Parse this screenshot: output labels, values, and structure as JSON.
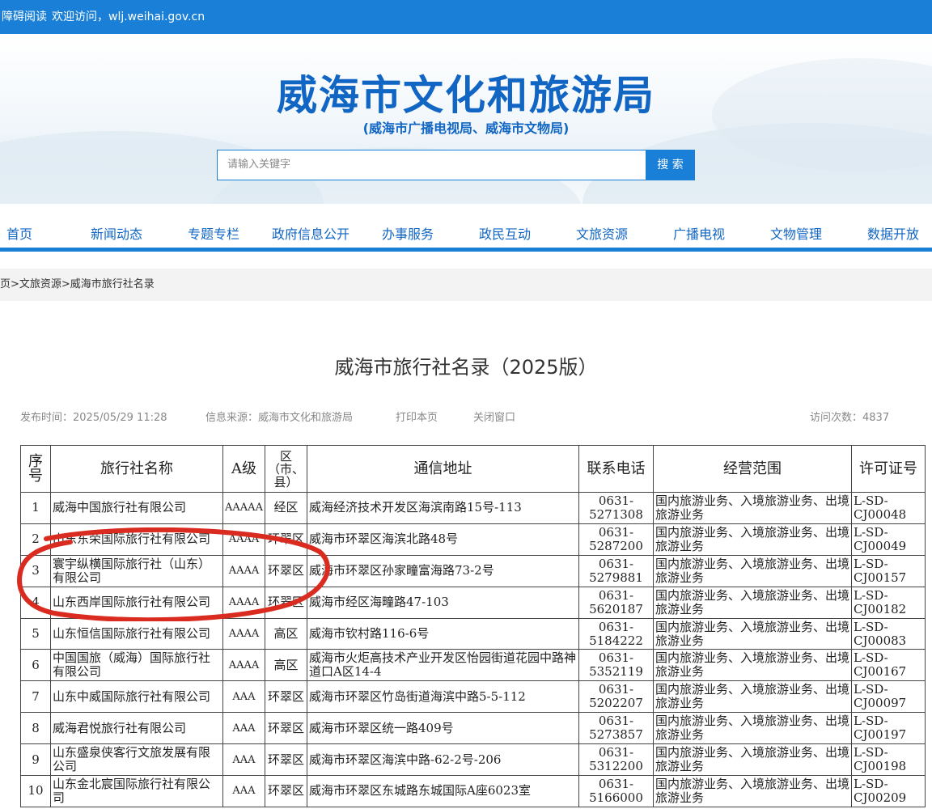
{
  "topbar": {
    "accessibility": "障碍阅读",
    "welcome": "欢迎访问，wlj.weihai.gov.cn"
  },
  "header": {
    "title": "威海市文化和旅游局",
    "subtitle": "(威海市广播电视局、威海市文物局)"
  },
  "search": {
    "placeholder": "请输入关键字",
    "button": "搜 索"
  },
  "nav": {
    "items": [
      "首页",
      "新闻动态",
      "专题专栏",
      "政府信息公开",
      "办事服务",
      "政民互动",
      "文旅资源",
      "广播电视",
      "文物管理",
      "数据开放"
    ]
  },
  "breadcrumb": "页>文旅资源>威海市旅行社名录",
  "article": {
    "title": "威海市旅行社名录（2025版）",
    "publish_time": "发布时间：2025/05/29 11:28",
    "source": "信息来源：威海市文化和旅游局",
    "print": "打印本页",
    "close": "关闭窗口",
    "visits": "访问次数：4837"
  },
  "table": {
    "headers": {
      "no": "序号",
      "name": "旅行社名称",
      "grade": "A级",
      "district": "区（市、县）",
      "address": "通信地址",
      "phone": "联系电话",
      "scope": "经营范围",
      "license": "许可证号"
    },
    "rows": [
      {
        "no": "1",
        "name": "威海中国旅行社有限公司",
        "grade": "AAAAA",
        "district": "经区",
        "address": "威海经济技术开发区海滨南路15号-113",
        "phone": "0631-5271308",
        "scope": "国内旅游业务、入境旅游业务、出境旅游业务",
        "license": "L-SD-CJ00048"
      },
      {
        "no": "2",
        "name": "山东东荣国际旅行社有限公司",
        "grade": "AAAA",
        "district": "环翠区",
        "address": "威海市环翠区海滨北路48号",
        "phone": "0631-5287200",
        "scope": "国内旅游业务、入境旅游业务、出境旅游业务",
        "license": "L-SD-CJ00049"
      },
      {
        "no": "3",
        "name": "寰宇纵横国际旅行社（山东）有限公司",
        "grade": "AAAA",
        "district": "环翠区",
        "address": "威海市环翠区孙家疃富海路73-2号",
        "phone": "0631-5279881",
        "scope": "国内旅游业务、入境旅游业务、出境旅游业务",
        "license": "L-SD-CJ00157"
      },
      {
        "no": "4",
        "name": "山东西岸国际旅行社有限公司",
        "grade": "AAAA",
        "district": "环翠区",
        "address": "威海市经区海疃路47-103",
        "phone": "0631-5620187",
        "scope": "国内旅游业务、入境旅游业务、出境旅游业务",
        "license": "L-SD-CJ00182"
      },
      {
        "no": "5",
        "name": "山东恒信国际旅行社有限公司",
        "grade": "AAAA",
        "district": "高区",
        "address": "威海市钦村路116-6号",
        "phone": "0631-5184222",
        "scope": "国内旅游业务、入境旅游业务、出境旅游业务",
        "license": "L-SD-CJ00083"
      },
      {
        "no": "6",
        "name": "中国国旅（威海）国际旅行社有限公司",
        "grade": "AAAA",
        "district": "高区",
        "address": "威海市火炬高技术产业开发区怡园街道花园中路神道口A区14-4",
        "phone": "0631-5352119",
        "scope": "国内旅游业务、入境旅游业务、出境旅游业务",
        "license": "L-SD-CJ00167"
      },
      {
        "no": "7",
        "name": "山东中威国际旅行社有限公司",
        "grade": "AAA",
        "district": "环翠区",
        "address": "威海市环翠区竹岛街道海滨中路5-5-112",
        "phone": "0631-5202207",
        "scope": "国内旅游业务、入境旅游业务、出境旅游业务",
        "license": "L-SD-CJ00097"
      },
      {
        "no": "8",
        "name": "威海君悦旅行社有限公司",
        "grade": "AAA",
        "district": "环翠区",
        "address": "威海市环翠区统一路409号",
        "phone": "0631-5273857",
        "scope": "国内旅游业务、入境旅游业务、出境旅游业务",
        "license": "L-SD-CJ00197"
      },
      {
        "no": "9",
        "name": "山东盛泉侠客行文旅发展有限公司",
        "grade": "AAA",
        "district": "环翠区",
        "address": "威海市环翠区海滨中路-62-2号-206",
        "phone": "0631-5312200",
        "scope": "国内旅游业务、入境旅游业务、出境旅游业务",
        "license": "L-SD-CJ00198"
      },
      {
        "no": "10",
        "name": "山东金北宸国际旅行社有限公司",
        "grade": "AAA",
        "district": "环翠区",
        "address": "威海市环翠区东城路东城国际A座6023室",
        "phone": "0631-5166000",
        "scope": "国内旅游业务、入境旅游业务、出境旅游业务",
        "license": "L-SD-CJ00209"
      }
    ]
  },
  "colors": {
    "brand_blue": "#1a7fd6",
    "title_blue": "#1166c4",
    "annotation_red": "#d92b1f"
  }
}
